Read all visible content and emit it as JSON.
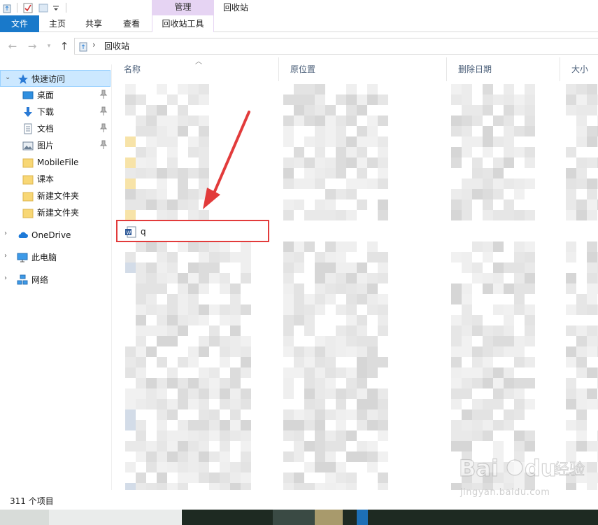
{
  "window": {
    "title": "回收站",
    "context_tab_group": "管理"
  },
  "ribbon": {
    "tabs": [
      {
        "label": "文件"
      },
      {
        "label": "主页"
      },
      {
        "label": "共享"
      },
      {
        "label": "查看"
      },
      {
        "label": "回收站工具"
      }
    ]
  },
  "address": {
    "breadcrumb": "回收站"
  },
  "nav": {
    "quick_access": {
      "label": "快速访问"
    },
    "items": [
      {
        "label": "桌面",
        "icon": "desktop-icon",
        "pinned": true
      },
      {
        "label": "下载",
        "icon": "download-icon",
        "pinned": true
      },
      {
        "label": "文档",
        "icon": "documents-icon",
        "pinned": true
      },
      {
        "label": "图片",
        "icon": "pictures-icon",
        "pinned": true
      },
      {
        "label": "MobileFile",
        "icon": "folder-icon",
        "pinned": false
      },
      {
        "label": "课本",
        "icon": "folder-icon",
        "pinned": false
      },
      {
        "label": "新建文件夹",
        "icon": "folder-icon",
        "pinned": false
      },
      {
        "label": "新建文件夹",
        "icon": "folder-icon",
        "pinned": false
      }
    ],
    "onedrive": {
      "label": "OneDrive"
    },
    "this_pc": {
      "label": "此电脑"
    },
    "network": {
      "label": "网络"
    }
  },
  "columns": {
    "name": "名称",
    "original_location": "原位置",
    "date_deleted": "删除日期",
    "size": "大小"
  },
  "highlighted_file": {
    "name": "q",
    "icon": "word-document-icon"
  },
  "status": {
    "item_count": "311 个项目"
  },
  "watermark": {
    "brand": "Baidu经验",
    "url": "jingyan.baidu.com"
  },
  "colors": {
    "accent": "#1979ca",
    "selection": "#cce8ff",
    "context_tab": "#e6d4f3",
    "annotation_red": "#e23b3b"
  }
}
